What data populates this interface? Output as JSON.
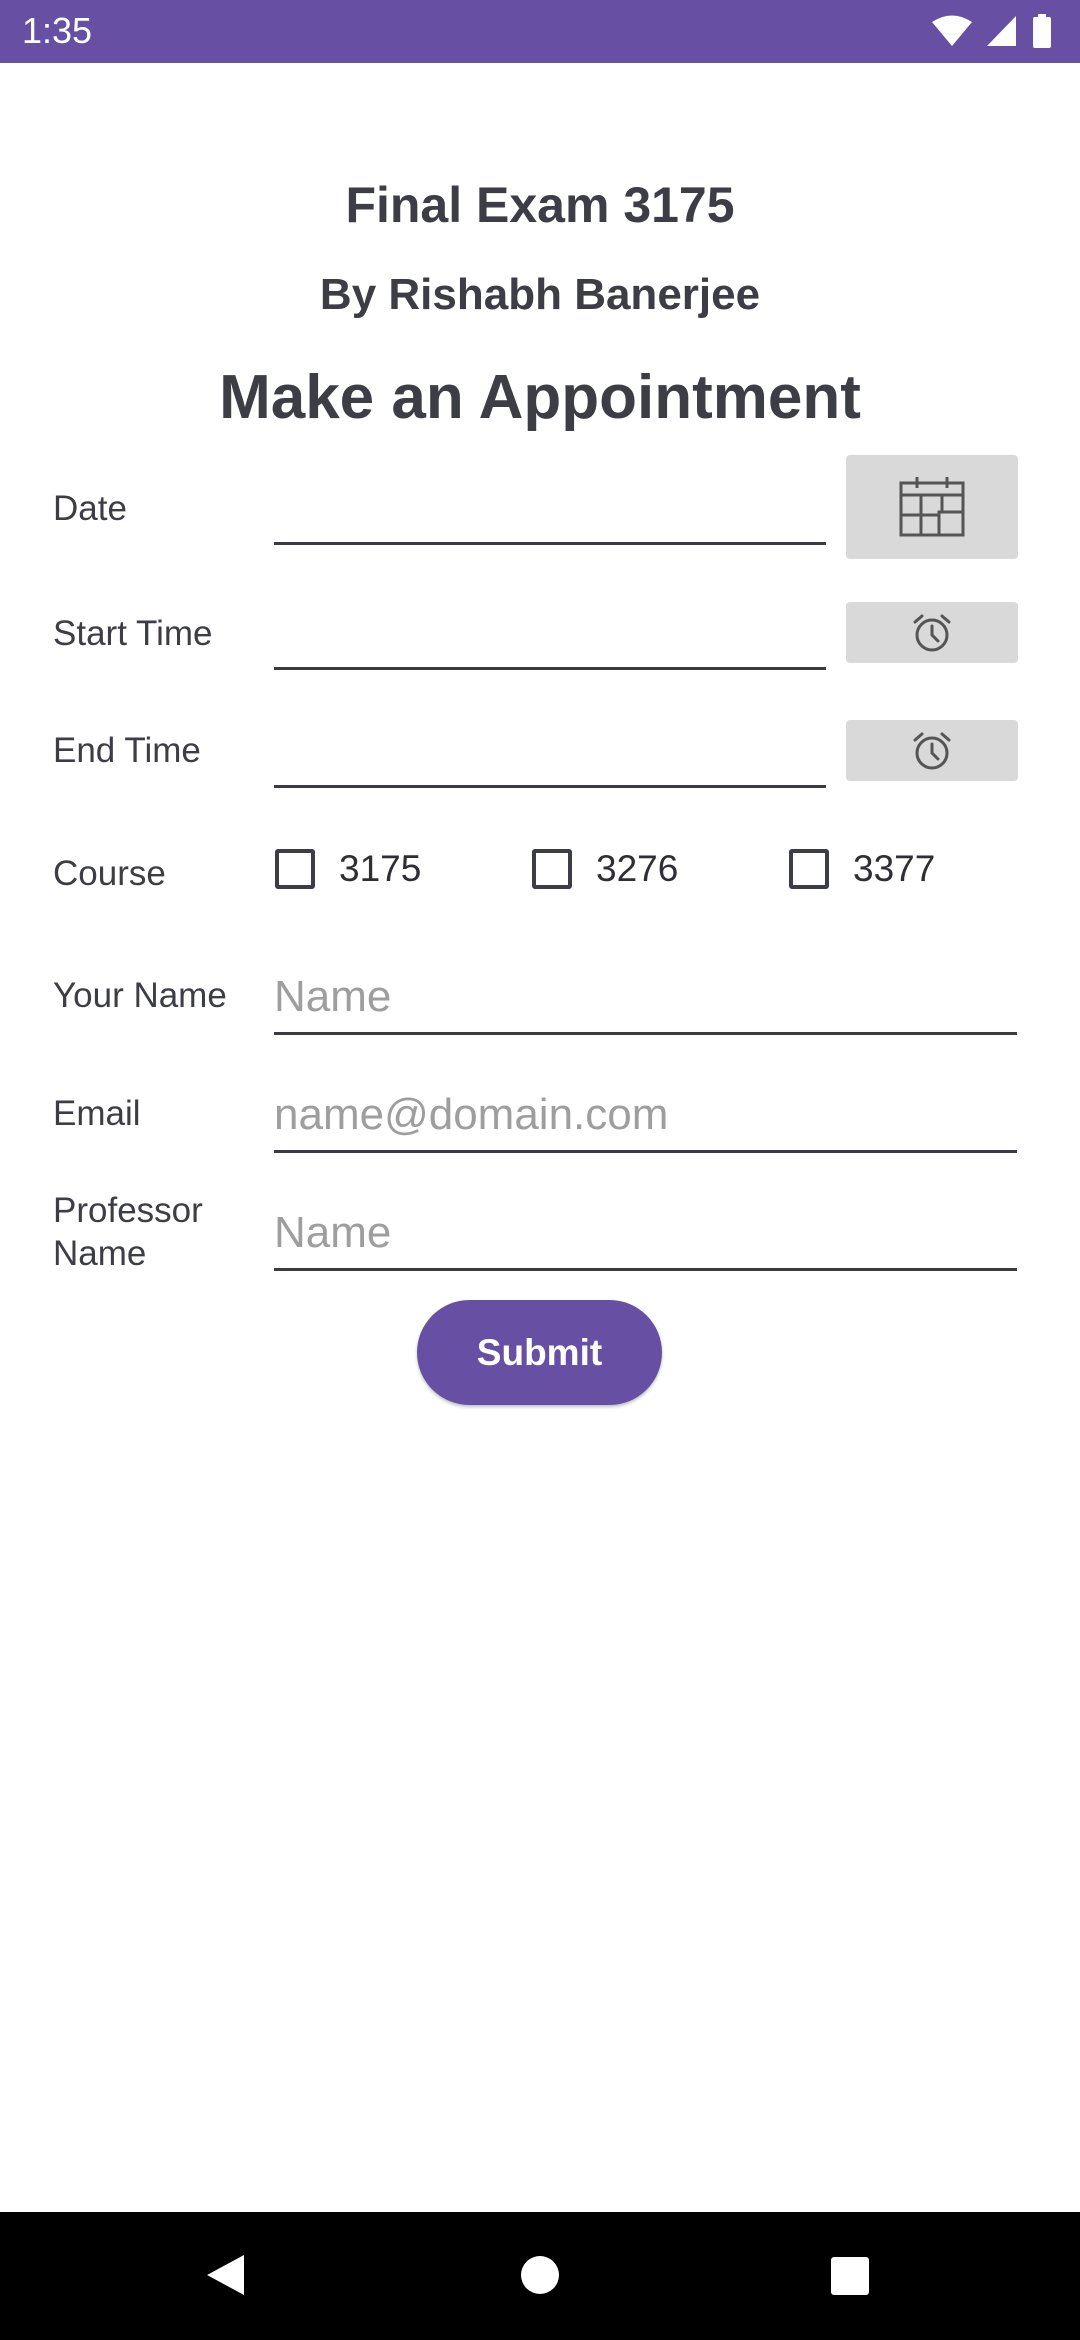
{
  "status_bar": {
    "time": "1:35",
    "icons": [
      "wifi-icon",
      "cell-signal-icon",
      "battery-icon"
    ],
    "color": "#6750a4"
  },
  "header": {
    "title": "Final Exam 3175",
    "author": "By Rishabh Banerjee",
    "heading": "Make an Appointment"
  },
  "form": {
    "date_label": "Date",
    "date_value": "",
    "start_time_label": "Start Time",
    "start_time_value": "",
    "end_time_label": "End Time",
    "end_time_value": "",
    "course_label": "Course",
    "courses": [
      {
        "label": "3175",
        "checked": false
      },
      {
        "label": "3276",
        "checked": false
      },
      {
        "label": "3377",
        "checked": false
      }
    ],
    "your_name_label": "Your Name",
    "your_name_placeholder": "Name",
    "email_label": "Email",
    "email_placeholder": "name@domain.com",
    "professor_label_line1": "Professor",
    "professor_label_line2": "Name",
    "professor_placeholder": "Name",
    "submit_label": "Submit"
  },
  "nav_bar": {
    "icons": [
      "back-icon",
      "home-icon",
      "recents-icon"
    ]
  }
}
